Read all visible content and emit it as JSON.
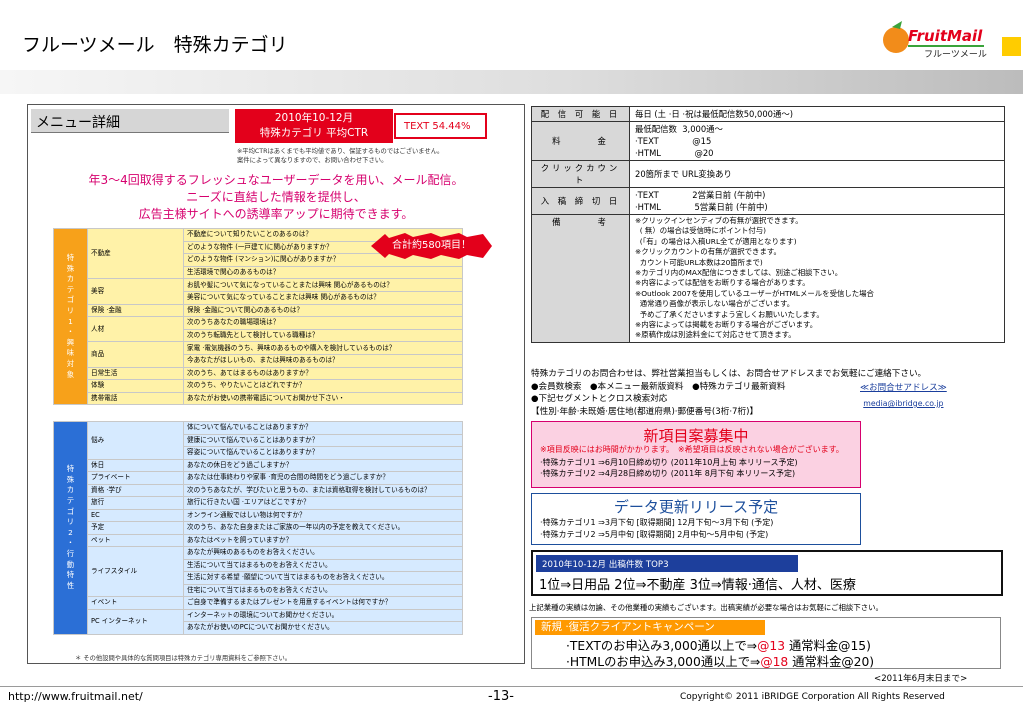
{
  "header": {
    "title": "フルーツメール　特殊カテゴリ",
    "logo_text": "FruitMail",
    "logo_sub": "フルーツメール"
  },
  "menu": {
    "title": "メニュー詳細",
    "ctr_label": "2010年10-12月",
    "ctr_label2": "特殊カテゴリ 平均CTR",
    "ctr_value": "TEXT  54.44%",
    "ctr_note": "※平均CTRはあくまでも平均値であり、保証するものではございません。",
    "ctr_note2": "案件によって異なりますので、お問い合わせ下さい。",
    "blurb": [
      "年3～4回取得するフレッシュなユーザーデータを用い、メール配信。",
      "ニーズに直結した情報を提供し、",
      "広告主様サイトへの誘導率アップに期待できます。"
    ],
    "badge": "合計約580項目！",
    "group1_label": [
      "特",
      "殊",
      "カ",
      "テ",
      "ゴ",
      "リ",
      "1",
      "・",
      "興",
      "味",
      "対",
      "象"
    ],
    "group2_label": [
      "特",
      "殊",
      "カ",
      "テ",
      "ゴ",
      "リ",
      "2",
      "・",
      "行",
      "動",
      "特",
      "性"
    ],
    "footnote": "＊ その他設問や具体的な質問項目は特殊カテゴリ専用資料をご参照下さい。",
    "group1": [
      {
        "cat": "不動産",
        "q": [
          "不動産について知りたいことのあるのは？",
          "どのような物件 (一戸建て)に関心がありますか？",
          "どのような物件 (マンション)に関心がありますか？",
          "生活環境で関心のあるものは？"
        ]
      },
      {
        "cat": "美容",
        "q": [
          "お肌や髪について気になっていることまたは興味 関心があるものは？",
          "美容について気になっていることまたは興味 関心があるものは？"
        ]
      },
      {
        "cat": "保険 ·金融",
        "q": [
          "保険 ·金融について関心のあるものは？"
        ]
      },
      {
        "cat": "人材",
        "q": [
          "次のうちあなたの職場環境は？",
          "次のうち転職先として検討している職種は？"
        ]
      },
      {
        "cat": "商品",
        "q": [
          "家電 ·電気機器のうち、興味のあるものや購入を検討しているものは？",
          "今あなたがほしいもの、または興味のあるものは？"
        ]
      },
      {
        "cat": "日常生活",
        "q": [
          "次のうち、あてはまるものはありますか？"
        ]
      },
      {
        "cat": "体験",
        "q": [
          "次のうち、やりたいことはどれですか？"
        ]
      },
      {
        "cat": "携帯電話",
        "q": [
          "あなたがお使いの携帯電話についてお聞かせ下さい・"
        ],
        "wide": true
      }
    ],
    "group2": [
      {
        "cat": "悩み",
        "q": [
          "体について悩んでいることはありますか？",
          "健康について悩んでいることはありますか？",
          "容姿について悩んでいることはありますか？"
        ]
      },
      {
        "cat": "休日",
        "q": [
          "あなたの休日をどう過ごしますか？"
        ]
      },
      {
        "cat": "プライベート",
        "q": [
          "あなたは仕事終わりや家事 ·育児の合間の時間をどう過ごしますか？"
        ]
      },
      {
        "cat": "資格 ·学び",
        "q": [
          "次のうちあなたが、学びたいと思うもの、または資格取得を検討しているものは？"
        ]
      },
      {
        "cat": "旅行",
        "q": [
          "旅行に行きたい国 ·エリアはどこですか？"
        ]
      },
      {
        "cat": "EC",
        "q": [
          "オンライン通販ではしい物は何ですか？"
        ]
      },
      {
        "cat": "予定",
        "q": [
          "次のうち、あなた自身またはご家族の一年以内の予定を教えてください。"
        ]
      },
      {
        "cat": "ペット",
        "q": [
          "あなたはペットを飼っていますか？"
        ]
      },
      {
        "cat": "ライフスタイル",
        "q": [
          "あなたが興味のあるものをお答えください。",
          "生活について当てはまるものをお答えください。",
          "生活に対する希望 ·願望について当てはまるものをお答えください。",
          "住宅について当てはまるものをお答えください。"
        ]
      },
      {
        "cat": "イベント",
        "q": [
          "ご自身で準備するまたはプレゼントを用意するイベントは何ですか？"
        ]
      },
      {
        "cat": "PC インターネット",
        "q": [
          "インターネットの環境についてお聞かせください。",
          "あなたがお使いのPCについてお聞かせください。"
        ]
      }
    ]
  },
  "delivery": [
    {
      "label": "配 信 可 能 日",
      "lines": [
        "毎日 (土 ·日 ·祝は最低配信数50,000通～)"
      ]
    },
    {
      "label": "料　　　金",
      "lines": [
        "最低配信数  3,000通～",
        "·TEXT　　　　@15",
        "·HTML　　　　@20"
      ]
    },
    {
      "label": "クリックカウント",
      "lines": [
        "20箇所まで URL変換あり"
      ]
    },
    {
      "label": "入 稿 締 切 日",
      "lines": [
        "·TEXT　　　　2営業日前 (午前中)",
        "·HTML　　　　5営業日前 (午前中)"
      ]
    },
    {
      "label": "備　　　考",
      "lines": [
        "※クリックインセンティブの有無が選択できます。",
        "  ( 無）の場合は受信時にポイント付与)",
        "  (「有」の場合は入稿URL全てが適用となります)",
        "※クリックカウントの有無が選択できます。",
        "  カウント可能URL本数は20箇所まで)",
        "※カテゴリ内のMAX配信につきましては、別途ご相談下さい。",
        "※内容によっては配信をお断りする場合があります。",
        "※Outlook 2007を使用しているユーザーがHTMLメールを受信した場合",
        "  通常通り画像が表示しない場合がございます。",
        "  予めご了承くださいますよう宜しくお願いいたします。",
        "※内容によっては掲載をお断りする場合がございます。",
        "※原稿作成は別途料金にて対応させて頂きます。"
      ]
    }
  ],
  "contact": {
    "lines": [
      "特殊カテゴリのお問合わせは、弊社営業担当もしくは、お問合せアドレスまでお気軽にご連絡下さい。",
      "●会員数検索　●本メニュー最新版資料　●特殊カテゴリ最新資料",
      "●下記セグメントとクロス検索対応",
      "【性別·年齢·未既婚·居住地(都道府県)·郵便番号(3桁·7桁)】"
    ],
    "addr_label": "≪お問合せアドレス≫",
    "email": "media@ibridge.co.jp"
  },
  "new_items": {
    "title": "新項目案募集中",
    "notes": "※項目反映にはお時間がかかります。　※希望項目は反映されない場合がございます。",
    "lines": [
      "·特殊カテゴリ1  ⇒6月10日締め切り  (2011年10月上旬  本リリース予定)",
      "·特殊カテゴリ2  ⇒4月28日締め切り  (2011年  8月下旬  本リリース予定)"
    ]
  },
  "update": {
    "title": "データ更新リリース予定",
    "lines": [
      "·特殊カテゴリ1  ⇒3月下旬 [取得期間]  12月下旬～3月下旬 (予定)",
      "·特殊カテゴリ2  ⇒5月中旬 [取得期間]   2月中旬～5月中旬 (予定)"
    ]
  },
  "top3": {
    "header": "2010年10-12月  出稿件数  TOP3",
    "value": "1位⇒日用品  2位⇒不動産  3位⇒情報·通信、人材、医療"
  },
  "achievements": "上記業種の実績は勿論、その他業種の実績もございます。出稿実績が必要な場合はお気軽にご相談下さい。",
  "campaign": {
    "header": "新規 ·復活クライアントキャンペーン",
    "text_pre": "·TEXTのお申込み3,000通以上で⇒",
    "text_price": "@13",
    "text_post": "  通常料金@15)",
    "html_pre": "·HTMLのお申込み3,000通以上で⇒",
    "html_price": "@18",
    "html_post": "  通常料金@20)"
  },
  "as_of": "<2011年6月末日まで>",
  "footer": {
    "url": "http://www.fruitmail.net/",
    "page": "-13-",
    "copyright": "Copyright© 2011 iBRIDGE Corporation All Rights Reserved"
  },
  "colors": {
    "orange": "#f7a11a",
    "blue": "#2b6fd6",
    "yellow_row": "#fff2a8",
    "blue_row": "#d6eaff",
    "red": "#e3001b",
    "pink": "#d6006e"
  }
}
